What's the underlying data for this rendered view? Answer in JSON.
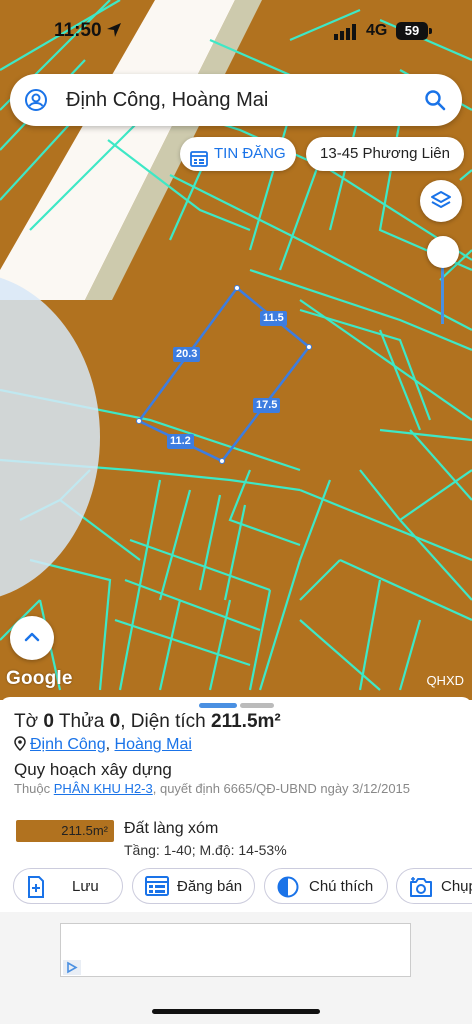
{
  "status_bar": {
    "time": "11:50",
    "network": "4G",
    "battery": "59"
  },
  "search": {
    "query": "Định Công, Hoàng Mai"
  },
  "chips": {
    "news_label": "TIN ĐĂNG",
    "address_label": "13-45 Phương Liên"
  },
  "map": {
    "attribution": "Google",
    "layer_label": "QHXD",
    "parcel_dimensions": [
      "20.3",
      "11.5",
      "17.5",
      "11.2"
    ],
    "land_color": "#b1721f",
    "line_color": "#3ee8c6",
    "parcel_outline_color": "#3d7de0"
  },
  "parcel": {
    "sheet_label": "Tờ",
    "sheet_no": "0",
    "plot_label": "Thửa",
    "plot_no": "0",
    "area_label": "Diện tích",
    "area": "211.5m²",
    "ward": "Định Công",
    "district": "Hoàng Mai",
    "address_separator": ",",
    "planning_title": "Quy hoạch xây dựng",
    "planning_prefix": "Thuộc",
    "planning_zone": "PHÂN KHU H2-3",
    "planning_decision": ", quyết định 6665/QĐ-UBND ngày 3/12/2015",
    "land_area_badge": "211.5m²",
    "land_type": "Đất làng xóm",
    "land_meta": "Tầng: 1-40; M.độ: 14-53%"
  },
  "actions": [
    {
      "label": "Lưu",
      "icon": "bookmark-plus-icon"
    },
    {
      "label": "Đăng bán",
      "icon": "listing-icon"
    },
    {
      "label": "Chú thích",
      "icon": "half-circle-icon"
    },
    {
      "label": "Chụp",
      "icon": "camera-plus-icon"
    }
  ]
}
